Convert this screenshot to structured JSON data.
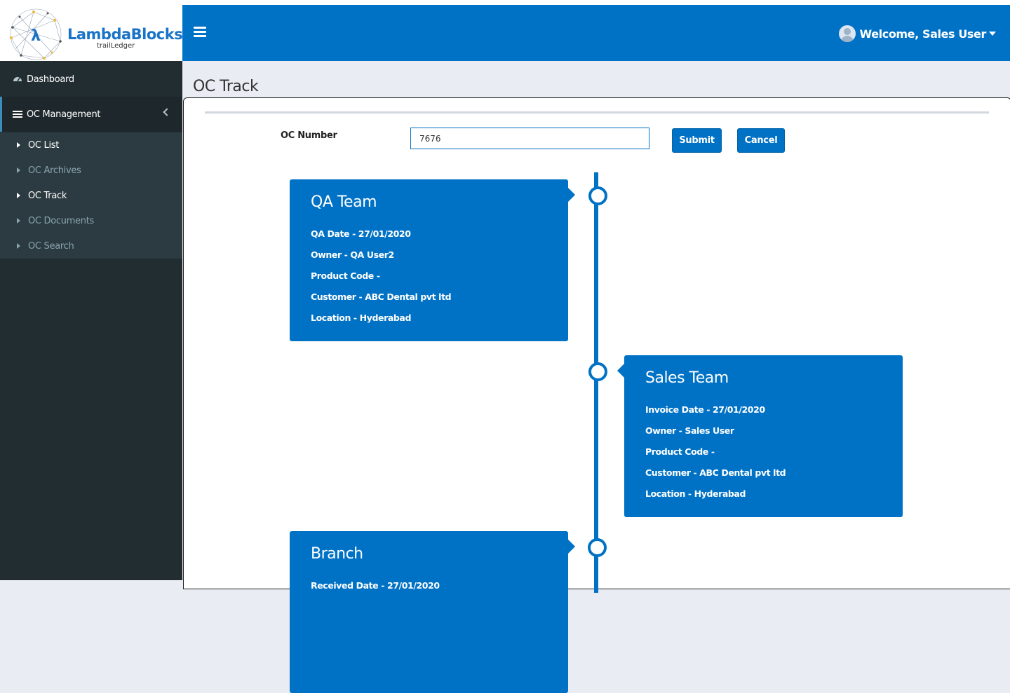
{
  "brand": {
    "name": "LambdaBlocks",
    "sub": "trailLedger",
    "color": "#1a73c7"
  },
  "header": {
    "welcome": "Welcome, Sales User",
    "bg": "#0072c6"
  },
  "sidebar": {
    "dashboard": "Dashboard",
    "oc_management": "OC Management",
    "items": [
      {
        "label": "OC List"
      },
      {
        "label": "OC Archives"
      },
      {
        "label": "OC Track"
      },
      {
        "label": "OC Documents"
      },
      {
        "label": "OC Search"
      }
    ]
  },
  "page": {
    "title": "OC Track"
  },
  "form": {
    "label": "OC Number",
    "value": "7676",
    "submit": "Submit",
    "cancel": "Cancel"
  },
  "timeline": [
    {
      "title": "QA Team",
      "lines": [
        "QA Date - 27/01/2020",
        "Owner - QA User2",
        "Product Code -",
        "Customer - ABC Dental pvt ltd",
        "Location - Hyderabad"
      ]
    },
    {
      "title": "Sales Team",
      "lines": [
        "Invoice Date - 27/01/2020",
        "Owner - Sales User",
        "Product Code -",
        "Customer - ABC Dental pvt ltd",
        "Location - Hyderabad"
      ]
    },
    {
      "title": "Branch",
      "lines": [
        "Received Date - 27/01/2020"
      ]
    }
  ]
}
